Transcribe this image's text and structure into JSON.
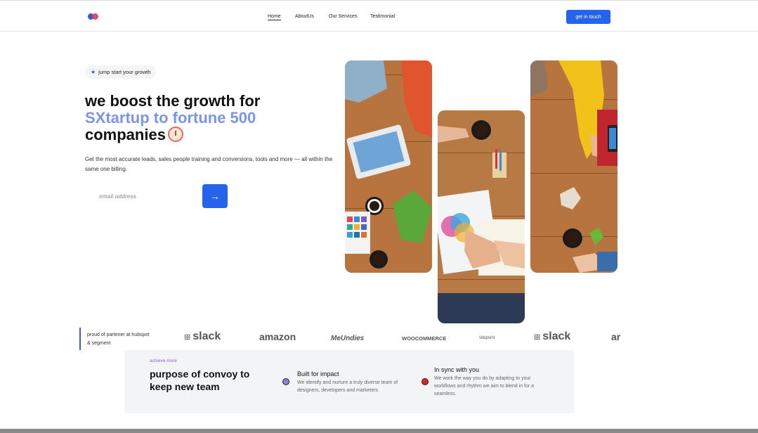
{
  "nav": {
    "items": [
      {
        "label": "Home",
        "active": true
      },
      {
        "label": "AboutUs",
        "active": false
      },
      {
        "label": "Our Services",
        "active": false
      },
      {
        "label": "Testimonial",
        "active": false
      }
    ],
    "cta_label": "get in touch"
  },
  "hero": {
    "badge_icon": "star-icon",
    "badge_label": "jump start your growth",
    "headline_line1": "we boost the growth for",
    "headline_accent": "SXtartup to fortune 500",
    "headline_line3": "companies",
    "headline_icon": "alarm-clock-icon",
    "subtext": "Get the most accurate leads, sales people training and conversions, tools and more — all within the same one billing.",
    "email_placeholder": "email address",
    "submit_icon": "arrow-right-icon",
    "submit_label": "→"
  },
  "partners": {
    "caption": "proud of partener at hubspot & segment",
    "logos": [
      "slack",
      "amazon",
      "MeUndies",
      "WOOCOMMERCE",
      "sitepoint",
      "slack",
      "ar"
    ]
  },
  "purpose": {
    "eyebrow": "achieve more",
    "title": "purpose of convoy to keep new team",
    "features": [
      {
        "title": "Built for impact",
        "text": "We identify and nurture a truly diverse team of designers, developers and marketers",
        "dot_color": "#8b7fe0"
      },
      {
        "title": "In sync with you",
        "text": "We work the way you do by adapting to your workflows and rhythm we aim to blend in for a seamless.",
        "dot_color": "#e02424"
      }
    ]
  },
  "colors": {
    "primary": "#2563eb",
    "accent_text": "#7b96e8",
    "eyebrow": "#8b5cf6"
  }
}
